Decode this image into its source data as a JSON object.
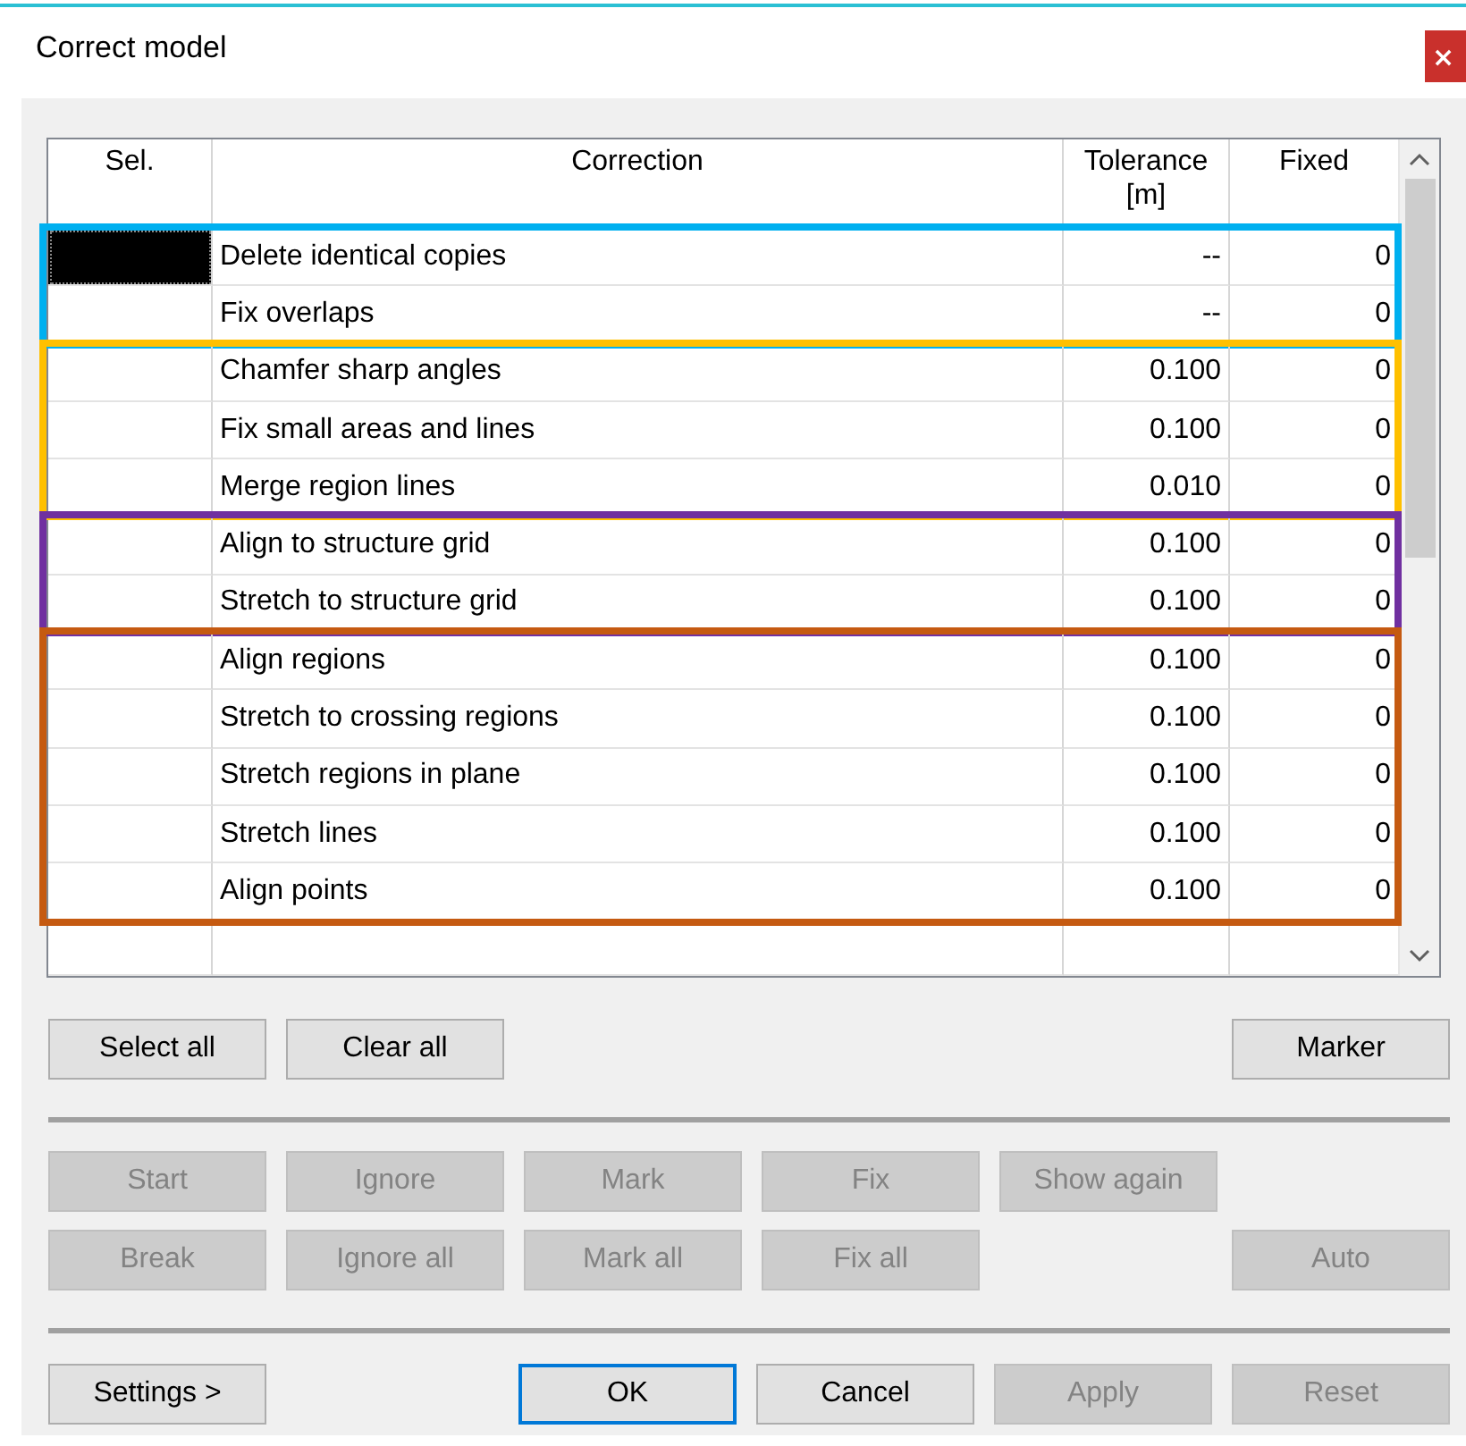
{
  "window": {
    "title": "Correct model",
    "close": "×"
  },
  "table": {
    "columns": [
      "Sel.",
      "Correction",
      "Tolerance [m]",
      "Fixed"
    ],
    "groups": [
      {
        "color": "#00b0f0",
        "rows": [
          {
            "selected": true,
            "correction": "Delete identical copies",
            "tolerance": "--",
            "fixed": "0"
          },
          {
            "selected": false,
            "correction": "Fix overlaps",
            "tolerance": "--",
            "fixed": "0"
          }
        ]
      },
      {
        "color": "#ffc000",
        "rows": [
          {
            "selected": false,
            "correction": "Chamfer sharp angles",
            "tolerance": "0.100",
            "fixed": "0"
          },
          {
            "selected": false,
            "correction": "Fix small areas and lines",
            "tolerance": "0.100",
            "fixed": "0"
          },
          {
            "selected": false,
            "correction": "Merge region lines",
            "tolerance": "0.010",
            "fixed": "0"
          }
        ]
      },
      {
        "color": "#7030a0",
        "rows": [
          {
            "selected": false,
            "correction": "Align to structure grid",
            "tolerance": "0.100",
            "fixed": "0"
          },
          {
            "selected": false,
            "correction": "Stretch to structure grid",
            "tolerance": "0.100",
            "fixed": "0"
          }
        ]
      },
      {
        "color": "#c55a11",
        "rows": [
          {
            "selected": false,
            "correction": "Align regions",
            "tolerance": "0.100",
            "fixed": "0"
          },
          {
            "selected": false,
            "correction": "Stretch to crossing regions",
            "tolerance": "0.100",
            "fixed": "0"
          },
          {
            "selected": false,
            "correction": "Stretch regions in plane",
            "tolerance": "0.100",
            "fixed": "0"
          },
          {
            "selected": false,
            "correction": "Stretch lines",
            "tolerance": "0.100",
            "fixed": "0"
          },
          {
            "selected": false,
            "correction": "Align points",
            "tolerance": "0.100",
            "fixed": "0"
          }
        ]
      }
    ]
  },
  "button_rows": [
    {
      "left": [
        {
          "label": "Select all",
          "disabled": false,
          "focused": false
        },
        {
          "label": "Clear all",
          "disabled": false,
          "focused": false
        }
      ],
      "right": [
        {
          "label": "Marker",
          "disabled": false,
          "focused": false
        }
      ]
    },
    {
      "left": [
        {
          "label": "Start",
          "disabled": true,
          "focused": false
        },
        {
          "label": "Ignore",
          "disabled": true,
          "focused": false
        },
        {
          "label": "Mark",
          "disabled": true,
          "focused": false
        },
        {
          "label": "Fix",
          "disabled": true,
          "focused": false
        },
        {
          "label": "Show again",
          "disabled": true,
          "focused": false
        }
      ],
      "right": []
    },
    {
      "left": [
        {
          "label": "Break",
          "disabled": true,
          "focused": false
        },
        {
          "label": "Ignore all",
          "disabled": true,
          "focused": false
        },
        {
          "label": "Mark all",
          "disabled": true,
          "focused": false
        },
        {
          "label": "Fix all",
          "disabled": true,
          "focused": false
        }
      ],
      "right": [
        {
          "label": "Auto",
          "disabled": true,
          "focused": false
        }
      ]
    },
    {
      "left": [
        {
          "label": "Settings >",
          "disabled": false,
          "focused": false
        }
      ],
      "right": [
        {
          "label": "OK",
          "disabled": false,
          "focused": true
        },
        {
          "label": "Cancel",
          "disabled": false,
          "focused": false
        },
        {
          "label": "Apply",
          "disabled": true,
          "focused": false
        },
        {
          "label": "Reset",
          "disabled": true,
          "focused": false
        }
      ]
    }
  ]
}
